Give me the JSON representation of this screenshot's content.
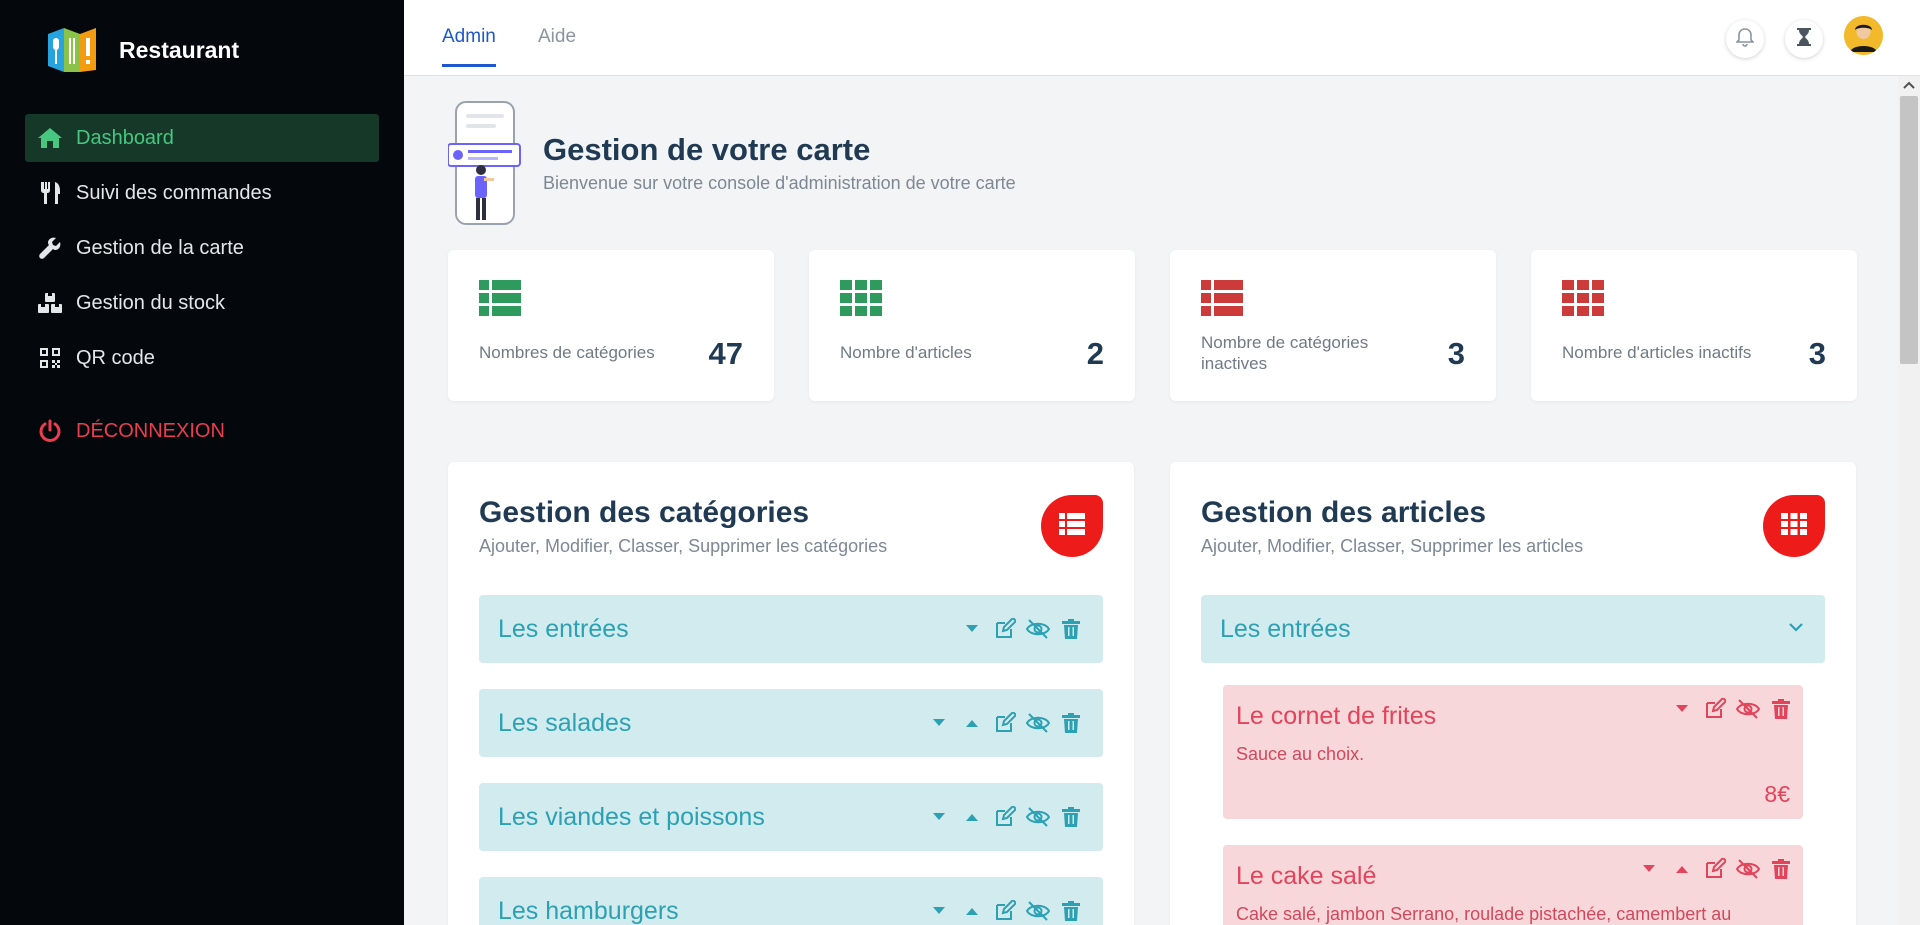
{
  "app": {
    "name": "Restaurant"
  },
  "sidebar": {
    "items": [
      {
        "label": "Dashboard",
        "icon": "home-icon"
      },
      {
        "label": "Suivi des commandes",
        "icon": "utensils-icon"
      },
      {
        "label": "Gestion de la carte",
        "icon": "wrench-icon"
      },
      {
        "label": "Gestion du stock",
        "icon": "boxes-icon"
      },
      {
        "label": "QR code",
        "icon": "qrcode-icon"
      }
    ],
    "logout": {
      "label": "DÉCONNEXION",
      "icon": "power-icon"
    }
  },
  "topbar": {
    "tabs": [
      {
        "label": "Admin"
      },
      {
        "label": "Aide"
      }
    ],
    "icons": [
      "bell-icon",
      "hourglass-icon",
      "avatar"
    ]
  },
  "hero": {
    "title": "Gestion de votre carte",
    "subtitle": "Bienvenue sur votre console d'administration de votre carte"
  },
  "stats": [
    {
      "label": "Nombres de catégories",
      "value": "47",
      "color": "#2f9a5e"
    },
    {
      "label": "Nombre d'articles",
      "value": "2",
      "color": "#2f9a5e"
    },
    {
      "label": "Nombre de catégories inactives",
      "value": "3",
      "color": "#cc3a3a"
    },
    {
      "label": "Nombre d'articles inactifs",
      "value": "3",
      "color": "#cc3a3a"
    }
  ],
  "categories_panel": {
    "title": "Gestion des catégories",
    "subtitle": "Ajouter, Modifier, Classer, Supprimer les catégories",
    "items": [
      {
        "label": "Les entrées"
      },
      {
        "label": "Les salades"
      },
      {
        "label": "Les viandes et poissons"
      },
      {
        "label": "Les hamburgers"
      }
    ]
  },
  "articles_panel": {
    "title": "Gestion des articles",
    "subtitle": "Ajouter, Modifier, Classer, Supprimer les articles",
    "category": {
      "label": "Les entrées"
    },
    "items": [
      {
        "title": "Le cornet de frites",
        "description": "Sauce au choix.",
        "price": "8€"
      },
      {
        "title": "Le cake salé",
        "description": "Cake salé, jambon Serrano, roulade pistachée, camembert au"
      }
    ]
  },
  "colors": {
    "accent": "#1c57d0",
    "active_nav_bg": "#163828",
    "active_nav_text": "#47c77f",
    "logout": "#ea3e4e",
    "category_bg": "#d1ebee",
    "category_text": "#2ca1b4",
    "article_bg": "#f8d7da",
    "article_text": "#e2445c",
    "badge_red": "#ee1b1b"
  }
}
